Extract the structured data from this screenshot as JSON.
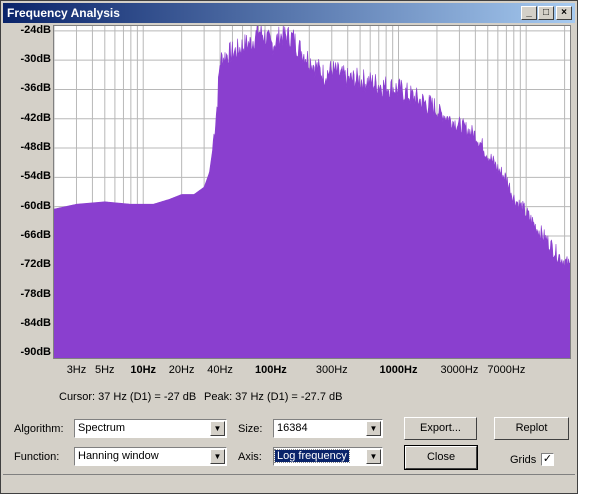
{
  "window": {
    "title": "Frequency Analysis",
    "minimize": "_",
    "maximize": "□",
    "close": "×"
  },
  "chart_data": {
    "type": "area",
    "xscale": "log",
    "xlabel": "",
    "ylabel": "",
    "xlim": [
      2,
      22050
    ],
    "ylim": [
      -91,
      -23
    ],
    "grid": true,
    "fill_color": "#8a3fcf",
    "y_ticks": [
      "-24dB",
      "-30dB",
      "-36dB",
      "-42dB",
      "-48dB",
      "-54dB",
      "-60dB",
      "-66dB",
      "-72dB",
      "-78dB",
      "-84dB",
      "-90dB"
    ],
    "y_tick_values": [
      -24,
      -30,
      -36,
      -42,
      -48,
      -54,
      -60,
      -66,
      -72,
      -78,
      -84,
      -90
    ],
    "x_ticks": [
      {
        "label": "3Hz",
        "value": 3,
        "major": false
      },
      {
        "label": "5Hz",
        "value": 5,
        "major": false
      },
      {
        "label": "10Hz",
        "value": 10,
        "major": true
      },
      {
        "label": "20Hz",
        "value": 20,
        "major": false
      },
      {
        "label": "40Hz",
        "value": 40,
        "major": false
      },
      {
        "label": "100Hz",
        "value": 100,
        "major": true
      },
      {
        "label": "300Hz",
        "value": 300,
        "major": false
      },
      {
        "label": "1000Hz",
        "value": 1000,
        "major": true
      },
      {
        "label": "3000Hz",
        "value": 3000,
        "major": false
      },
      {
        "label": "7000Hz",
        "value": 7000,
        "major": false
      }
    ],
    "x": [
      2,
      3,
      5,
      8,
      12,
      16,
      20,
      25,
      30,
      33,
      36,
      38,
      40,
      45,
      55,
      60,
      70,
      80,
      90,
      100,
      110,
      120,
      130,
      150,
      160,
      200,
      260,
      300,
      400,
      500,
      700,
      1000,
      1400,
      2000,
      2600,
      3000,
      4000,
      5000,
      6000,
      7000,
      8000,
      10000,
      12000,
      15000,
      17000,
      20000,
      22050
    ],
    "values": [
      -60.5,
      -59.5,
      -59,
      -59.5,
      -59.5,
      -58.5,
      -57.5,
      -57.5,
      -56,
      -53,
      -46,
      -40,
      -31,
      -30,
      -29,
      -28,
      -27.5,
      -25,
      -26,
      -28,
      -27,
      -26,
      -26,
      -26.5,
      -28,
      -31,
      -34,
      -33,
      -35,
      -35,
      -36,
      -37,
      -39,
      -41,
      -43,
      -44,
      -46,
      -50,
      -53,
      -55,
      -59,
      -62,
      -65,
      -68,
      -70,
      -72,
      -73
    ]
  },
  "status": {
    "cursor": "Cursor: 37 Hz (D1) = -27 dB",
    "peak": "Peak: 37 Hz (D1) = -27.7 dB"
  },
  "controls": {
    "algorithm_label": "Algorithm:",
    "algorithm_value": "Spectrum",
    "function_label": "Function:",
    "function_value": "Hanning window",
    "size_label": "Size:",
    "size_value": "16384",
    "axis_label": "Axis:",
    "axis_value": "Log frequency",
    "export_label": "Export...",
    "replot_label": "Replot",
    "close_label": "Close",
    "grids_label": "Grids",
    "grids_checked": "✓",
    "combo_arrow": "▼"
  }
}
